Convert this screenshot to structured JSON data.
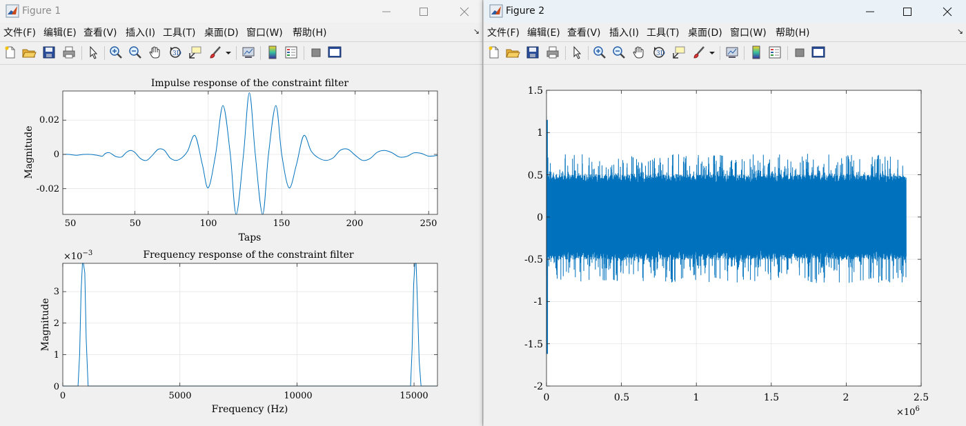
{
  "menus": [
    "文件(F)",
    "编辑(E)",
    "查看(V)",
    "插入(I)",
    "工具(T)",
    "桌面(D)",
    "窗口(W)",
    "帮助(H)"
  ],
  "menu_overflow": "↘",
  "toolbar_icons": [
    "new-figure-icon",
    "open-file-icon",
    "save-icon",
    "print-icon",
    "select-arrow-icon",
    "zoom-in-icon",
    "zoom-out-icon",
    "pan-hand-icon",
    "rotate-3d-icon",
    "data-cursor-icon",
    "brush-icon",
    "brush-dropdown-icon",
    "link-plot-icon",
    "colorbar-icon",
    "legend-icon",
    "hide-plot-tools-icon",
    "show-plot-tools-icon"
  ],
  "figure1": {
    "title": "Figure 1",
    "plot1": {
      "title": "Impulse response of the constraint filter",
      "xlabel": "Taps",
      "ylabel": "Magnitude",
      "xticks": [
        "50",
        "100",
        "150",
        "200",
        "250"
      ],
      "yticks": [
        "0.02",
        "0",
        "-0.02"
      ]
    },
    "plot2": {
      "title": "Frequency response of the constraint filter",
      "xlabel": "Frequency (Hz)",
      "ylabel": "Magnitude",
      "xticks": [
        "0",
        "5000",
        "10000",
        "15000"
      ],
      "yticks": [
        "3",
        "2",
        "1",
        "0"
      ],
      "exponent_base": "×10",
      "exponent_power": "−3"
    }
  },
  "figure2": {
    "title": "Figure 2",
    "plot": {
      "xticks": [
        "0",
        "0.5",
        "1",
        "1.5",
        "2",
        "2.5"
      ],
      "yticks": [
        "1.5",
        "1",
        "0.5",
        "0",
        "-0.5",
        "-1",
        "-1.5",
        "-2"
      ],
      "exponent_base": "×10",
      "exponent_power": "6"
    }
  },
  "colors": {
    "line": "#0072bd",
    "grid": "#e4e4e4",
    "axes_bg": "#ffffff"
  },
  "chart_data": [
    {
      "type": "line",
      "title": "Impulse response of the constraint filter",
      "xlabel": "Taps",
      "ylabel": "Magnitude",
      "xlim": [
        1,
        256
      ],
      "ylim": [
        -0.035,
        0.037
      ],
      "series": [
        {
          "x": [
            1,
            5,
            10,
            15,
            20,
            25,
            28,
            30,
            33,
            37,
            41,
            44,
            47,
            50,
            54,
            58,
            62,
            66,
            70,
            74,
            78,
            82,
            86,
            91,
            96,
            100,
            105,
            110,
            115,
            119,
            124,
            128,
            132,
            137,
            141,
            146,
            150,
            155,
            160,
            165,
            170,
            175,
            180,
            185,
            190,
            195,
            200,
            205,
            210,
            215,
            220,
            225,
            230,
            235,
            240,
            245,
            250,
            256
          ],
          "y": [
            0,
            0,
            -0.0005,
            0,
            0,
            -0.0006,
            -0.001,
            0.0006,
            0.0009,
            -0.0012,
            -0.0015,
            0.001,
            0.0023,
            0.0012,
            -0.0025,
            -0.0035,
            -0.0005,
            0.003,
            0.0025,
            -0.002,
            -0.0035,
            -0.002,
            0.002,
            0.011,
            -0.006,
            -0.0195,
            0.0,
            0.0285,
            0.0,
            -0.035,
            0.0,
            0.036,
            0.0,
            -0.035,
            0.0,
            0.0285,
            0.0,
            -0.0195,
            -0.006,
            0.011,
            0.002,
            -0.002,
            -0.0035,
            -0.002,
            0.0025,
            0.003,
            -0.0005,
            -0.0035,
            -0.0025,
            0.0012,
            0.0023,
            0.001,
            -0.0015,
            -0.0012,
            0.0009,
            0.0006,
            -0.001,
            -0.0006
          ]
        }
      ]
    },
    {
      "type": "line",
      "title": "Frequency response of the constraint filter",
      "xlabel": "Frequency (Hz)",
      "ylabel": "Magnitude",
      "xlim": [
        0,
        16000
      ],
      "ylim": [
        0,
        0.0039
      ],
      "series": [
        {
          "x": [
            0,
            650,
            720,
            780,
            840,
            880,
            940,
            1000,
            1080,
            14850,
            14920,
            14980,
            15040,
            15090,
            15150,
            15220,
            15300,
            16000
          ],
          "y": [
            0,
            0,
            0.001,
            0.003,
            0.0039,
            0.0041,
            0.0036,
            0.0015,
            0,
            0,
            0.0012,
            0.0032,
            0.0041,
            0.004,
            0.0025,
            0.0008,
            0,
            0
          ]
        }
      ]
    },
    {
      "type": "line",
      "xlim": [
        0,
        2500000
      ],
      "ylim": [
        -2,
        1.5
      ],
      "x_scale": 1000000,
      "series": [
        {
          "x_range": [
            0,
            2400000
          ],
          "envelope_max": 0.75,
          "envelope_min": -0.78,
          "typical_amplitude": 0.5,
          "start_spike": [
            1.15,
            -1.62
          ]
        }
      ]
    }
  ]
}
